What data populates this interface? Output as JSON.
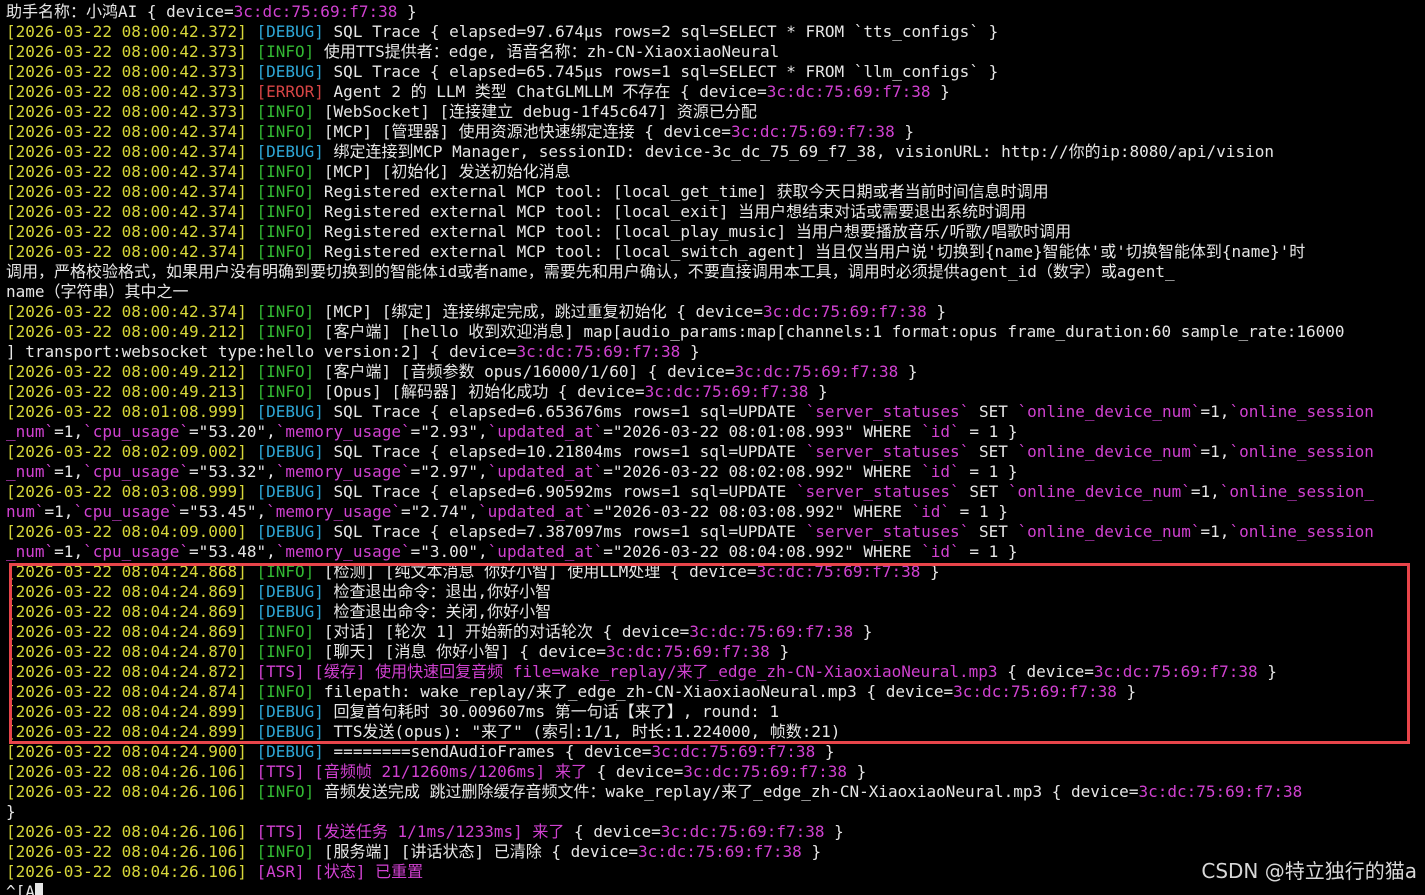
{
  "header": {
    "text": "助手名称：小鸿AI { device=",
    "device": "3c:dc:75:69:f7:38",
    "suffix": " }"
  },
  "log": [
    {
      "ts": "[2026-03-22 08:00:42.372]",
      "level": "DEBUG",
      "segs": [
        [
          "SQL Trace { elapsed=97.674µs rows=2 sql=SELECT * FROM `tts_configs` }",
          ""
        ]
      ]
    },
    {
      "ts": "[2026-03-22 08:00:42.373]",
      "level": "INFO",
      "segs": [
        [
          "使用TTS提供者：edge, 语音名称：zh-CN-XiaoxiaoNeural",
          ""
        ]
      ]
    },
    {
      "ts": "[2026-03-22 08:00:42.373]",
      "level": "DEBUG",
      "segs": [
        [
          "SQL Trace { elapsed=65.745µs rows=1 sql=SELECT * FROM `llm_configs` }",
          ""
        ]
      ]
    },
    {
      "ts": "[2026-03-22 08:00:42.373]",
      "level": "ERROR",
      "segs": [
        [
          "Agent 2 的 LLM 类型 ChatGLMLLM 不存在 { device=",
          ""
        ],
        [
          "3c:dc:75:69:f7:38",
          "hl"
        ],
        [
          " }",
          ""
        ]
      ]
    },
    {
      "ts": "[2026-03-22 08:00:42.373]",
      "level": "INFO",
      "segs": [
        [
          "[WebSocket] [连接建立 debug-1f45c647] 资源已分配",
          ""
        ]
      ]
    },
    {
      "ts": "[2026-03-22 08:00:42.374]",
      "level": "INFO",
      "segs": [
        [
          "[MCP] [管理器] 使用资源池快速绑定连接 { device=",
          ""
        ],
        [
          "3c:dc:75:69:f7:38",
          "hl"
        ],
        [
          " }",
          ""
        ]
      ]
    },
    {
      "ts": "[2026-03-22 08:00:42.374]",
      "level": "DEBUG",
      "segs": [
        [
          "绑定连接到MCP Manager, sessionID: device-3c_dc_75_69_f7_38, visionURL: http://你的ip:8080/api/vision",
          ""
        ]
      ]
    },
    {
      "ts": "[2026-03-22 08:00:42.374]",
      "level": "INFO",
      "segs": [
        [
          "[MCP] [初始化] 发送初始化消息",
          ""
        ]
      ]
    },
    {
      "ts": "[2026-03-22 08:00:42.374]",
      "level": "INFO",
      "segs": [
        [
          "Registered external MCP tool: [local_get_time] 获取今天日期或者当前时间信息时调用",
          ""
        ]
      ]
    },
    {
      "ts": "[2026-03-22 08:00:42.374]",
      "level": "INFO",
      "segs": [
        [
          "Registered external MCP tool: [local_exit] 当用户想结束对话或需要退出系统时调用",
          ""
        ]
      ]
    },
    {
      "ts": "[2026-03-22 08:00:42.374]",
      "level": "INFO",
      "segs": [
        [
          "Registered external MCP tool: [local_play_music] 当用户想要播放音乐/听歌/唱歌时调用",
          ""
        ]
      ]
    },
    {
      "ts": "[2026-03-22 08:00:42.374]",
      "level": "INFO",
      "segs": [
        [
          "Registered external MCP tool: [local_switch_agent] 当且仅当用户说'切换到{name}智能体'或'切换智能体到{name}'时",
          ""
        ]
      ]
    },
    {
      "ts": "",
      "level": "",
      "segs": [
        [
          "调用，严格校验格式，如果用户没有明确到要切换到的智能体id或者name，需要先和用户确认，不要直接调用本工具，调用时必须提供agent_id（数字）或agent_",
          ""
        ]
      ]
    },
    {
      "ts": "",
      "level": "",
      "segs": [
        [
          "name（字符串）其中之一",
          ""
        ]
      ]
    },
    {
      "ts": "[2026-03-22 08:00:42.374]",
      "level": "INFO",
      "segs": [
        [
          "[MCP] [绑定] 连接绑定完成，跳过重复初始化 { device=",
          ""
        ],
        [
          "3c:dc:75:69:f7:38",
          "hl"
        ],
        [
          " }",
          ""
        ]
      ]
    },
    {
      "ts": "[2026-03-22 08:00:49.212]",
      "level": "INFO",
      "segs": [
        [
          "[客户端] [hello 收到欢迎消息] map[audio_params:map[channels:1 format:opus frame_duration:60 sample_rate:16000",
          ""
        ]
      ]
    },
    {
      "ts": "",
      "level": "",
      "segs": [
        [
          "] transport:websocket type:hello version:2] { device=",
          ""
        ],
        [
          "3c:dc:75:69:f7:38",
          "hl"
        ],
        [
          " }",
          ""
        ]
      ]
    },
    {
      "ts": "[2026-03-22 08:00:49.212]",
      "level": "INFO",
      "segs": [
        [
          "[客户端] [音频参数 opus/16000/1/60] { device=",
          ""
        ],
        [
          "3c:dc:75:69:f7:38",
          "hl"
        ],
        [
          " }",
          ""
        ]
      ]
    },
    {
      "ts": "[2026-03-22 08:00:49.213]",
      "level": "INFO",
      "segs": [
        [
          "[Opus] [解码器] 初始化成功 { device=",
          ""
        ],
        [
          "3c:dc:75:69:f7:38",
          "hl"
        ],
        [
          " }",
          ""
        ]
      ]
    },
    {
      "ts": "[2026-03-22 08:01:08.999]",
      "level": "DEBUG",
      "segs": [
        [
          "SQL Trace { elapsed=6.653676ms rows=1 sql=UPDATE ",
          ""
        ],
        [
          "`server_statuses`",
          "hl"
        ],
        [
          " SET ",
          ""
        ],
        [
          "`online_device_num`",
          "hl"
        ],
        [
          "=1,",
          ""
        ],
        [
          "`online_session",
          "hl"
        ]
      ]
    },
    {
      "ts": "",
      "level": "",
      "segs": [
        [
          "_num`",
          "hl"
        ],
        [
          "=1,",
          ""
        ],
        [
          "`cpu_usage`",
          "hl"
        ],
        [
          "=\"53.20\",",
          ""
        ],
        [
          "`memory_usage`",
          "hl"
        ],
        [
          "=\"2.93\",",
          ""
        ],
        [
          "`updated_at`",
          "hl"
        ],
        [
          "=\"2026-03-22 08:01:08.993\" WHERE ",
          ""
        ],
        [
          "`id`",
          "hl"
        ],
        [
          " = 1 }",
          ""
        ]
      ]
    },
    {
      "ts": "[2026-03-22 08:02:09.002]",
      "level": "DEBUG",
      "segs": [
        [
          "SQL Trace { elapsed=10.21804ms rows=1 sql=UPDATE ",
          ""
        ],
        [
          "`server_statuses`",
          "hl"
        ],
        [
          " SET ",
          ""
        ],
        [
          "`online_device_num`",
          "hl"
        ],
        [
          "=1,",
          ""
        ],
        [
          "`online_session",
          "hl"
        ]
      ]
    },
    {
      "ts": "",
      "level": "",
      "segs": [
        [
          "_num`",
          "hl"
        ],
        [
          "=1,",
          ""
        ],
        [
          "`cpu_usage`",
          "hl"
        ],
        [
          "=\"53.32\",",
          ""
        ],
        [
          "`memory_usage`",
          "hl"
        ],
        [
          "=\"2.97\",",
          ""
        ],
        [
          "`updated_at`",
          "hl"
        ],
        [
          "=\"2026-03-22 08:02:08.992\" WHERE ",
          ""
        ],
        [
          "`id`",
          "hl"
        ],
        [
          " = 1 }",
          ""
        ]
      ]
    },
    {
      "ts": "[2026-03-22 08:03:08.999]",
      "level": "DEBUG",
      "segs": [
        [
          "SQL Trace { elapsed=6.90592ms rows=1 sql=UPDATE ",
          ""
        ],
        [
          "`server_statuses`",
          "hl"
        ],
        [
          " SET ",
          ""
        ],
        [
          "`online_device_num`",
          "hl"
        ],
        [
          "=1,",
          ""
        ],
        [
          "`online_session_",
          "hl"
        ]
      ]
    },
    {
      "ts": "",
      "level": "",
      "segs": [
        [
          "num`",
          "hl"
        ],
        [
          "=1,",
          ""
        ],
        [
          "`cpu_usage`",
          "hl"
        ],
        [
          "=\"53.45\",",
          ""
        ],
        [
          "`memory_usage`",
          "hl"
        ],
        [
          "=\"2.74\",",
          ""
        ],
        [
          "`updated_at`",
          "hl"
        ],
        [
          "=\"2026-03-22 08:03:08.992\" WHERE ",
          ""
        ],
        [
          "`id`",
          "hl"
        ],
        [
          " = 1 }",
          ""
        ]
      ]
    },
    {
      "ts": "[2026-03-22 08:04:09.000]",
      "level": "DEBUG",
      "segs": [
        [
          "SQL Trace { elapsed=7.387097ms rows=1 sql=UPDATE ",
          ""
        ],
        [
          "`server_statuses`",
          "hl"
        ],
        [
          " SET ",
          ""
        ],
        [
          "`online_device_num`",
          "hl"
        ],
        [
          "=1,",
          ""
        ],
        [
          "`online_session",
          "hl"
        ]
      ]
    },
    {
      "ts": "",
      "level": "",
      "segs": [
        [
          "_num`",
          "hl"
        ],
        [
          "=1,",
          ""
        ],
        [
          "`cpu_usage`",
          "hl"
        ],
        [
          "=\"53.48\",",
          ""
        ],
        [
          "`memory_usage`",
          "hl"
        ],
        [
          "=\"3.00\",",
          ""
        ],
        [
          "`updated_at`",
          "hl"
        ],
        [
          "=\"2026-03-22 08:04:08.992\" WHERE ",
          ""
        ],
        [
          "`id`",
          "hl"
        ],
        [
          " = 1 }",
          ""
        ]
      ]
    },
    {
      "ts": "[2026-03-22 08:04:24.868]",
      "level": "INFO",
      "segs": [
        [
          "[检测] [纯文本消息 你好小智] 使用LLM处理 { device=",
          ""
        ],
        [
          "3c:dc:75:69:f7:38",
          "hl"
        ],
        [
          " }",
          ""
        ]
      ]
    },
    {
      "ts": "[2026-03-22 08:04:24.869]",
      "level": "DEBUG",
      "segs": [
        [
          "检查退出命令：退出,你好小智",
          ""
        ]
      ]
    },
    {
      "ts": "[2026-03-22 08:04:24.869]",
      "level": "DEBUG",
      "segs": [
        [
          "检查退出命令：关闭,你好小智",
          ""
        ]
      ]
    },
    {
      "ts": "[2026-03-22 08:04:24.869]",
      "level": "INFO",
      "segs": [
        [
          "[对话] [轮次 1] 开始新的对话轮次 { device=",
          ""
        ],
        [
          "3c:dc:75:69:f7:38",
          "hl"
        ],
        [
          " }",
          ""
        ]
      ]
    },
    {
      "ts": "[2026-03-22 08:04:24.870]",
      "level": "INFO",
      "segs": [
        [
          "[聊天] [消息 你好小智] { device=",
          ""
        ],
        [
          "3c:dc:75:69:f7:38",
          "hl"
        ],
        [
          " }",
          ""
        ]
      ]
    },
    {
      "ts": "[2026-03-22 08:04:24.872]",
      "level": "TTS",
      "segs": [
        [
          "[缓存] 使用快速回复音频 file=wake_replay/来了_edge_zh-CN-XiaoxiaoNeural.mp3",
          "ttsmsg"
        ],
        [
          " { device=",
          ""
        ],
        [
          "3c:dc:75:69:f7:38",
          "hl"
        ],
        [
          " }",
          ""
        ]
      ]
    },
    {
      "ts": "[2026-03-22 08:04:24.874]",
      "level": "INFO",
      "segs": [
        [
          "filepath: wake_replay/来了_edge_zh-CN-XiaoxiaoNeural.mp3 { device=",
          ""
        ],
        [
          "3c:dc:75:69:f7:38",
          "hl"
        ],
        [
          " }",
          ""
        ]
      ]
    },
    {
      "ts": "[2026-03-22 08:04:24.899]",
      "level": "DEBUG",
      "segs": [
        [
          "回复首句耗时 30.009607ms 第一句话【来了】, round: 1",
          ""
        ]
      ]
    },
    {
      "ts": "[2026-03-22 08:04:24.899]",
      "level": "DEBUG",
      "segs": [
        [
          "TTS发送(opus): \"来了\" (索引:1/1, 时长:1.224000, 帧数:21)",
          ""
        ]
      ]
    },
    {
      "ts": "[2026-03-22 08:04:24.900]",
      "level": "DEBUG",
      "segs": [
        [
          "========sendAudioFrames { device=",
          ""
        ],
        [
          "3c:dc:75:69:f7:38",
          "hl"
        ],
        [
          " }",
          ""
        ]
      ]
    },
    {
      "ts": "[2026-03-22 08:04:26.106]",
      "level": "TTS",
      "segs": [
        [
          "[音频帧 21/1260ms/1206ms] 来了",
          "ttsmsg"
        ],
        [
          " { device=",
          ""
        ],
        [
          "3c:dc:75:69:f7:38",
          "hl"
        ],
        [
          " }",
          ""
        ]
      ]
    },
    {
      "ts": "[2026-03-22 08:04:26.106]",
      "level": "INFO",
      "segs": [
        [
          "音频发送完成 跳过删除缓存音频文件：wake_replay/来了_edge_zh-CN-XiaoxiaoNeural.mp3 { device=",
          ""
        ],
        [
          "3c:dc:75:69:f7:38",
          "hl"
        ]
      ]
    },
    {
      "ts": "",
      "level": "",
      "segs": [
        [
          "}",
          ""
        ]
      ]
    },
    {
      "ts": "[2026-03-22 08:04:26.106]",
      "level": "TTS",
      "segs": [
        [
          "[发送任务 1/1ms/1233ms] 来了",
          "ttsmsg"
        ],
        [
          " { device=",
          ""
        ],
        [
          "3c:dc:75:69:f7:38",
          "hl"
        ],
        [
          " }",
          ""
        ]
      ]
    },
    {
      "ts": "[2026-03-22 08:04:26.106]",
      "level": "INFO",
      "segs": [
        [
          "[服务端] [讲话状态] 已清除 { device=",
          ""
        ],
        [
          "3c:dc:75:69:f7:38",
          "hl"
        ],
        [
          " }",
          ""
        ]
      ]
    },
    {
      "ts": "[2026-03-22 08:04:26.106]",
      "level": "ASR",
      "segs": [
        [
          "[状态] 已重置",
          "ttsmsg"
        ]
      ]
    }
  ],
  "prompt": "^[A",
  "watermark": "CSDN @特立独行的猫a",
  "colors": {
    "background": "#000000",
    "timestamp": "#d6d639",
    "debug": "#2ea8d8",
    "info": "#33b833",
    "error": "#d64545",
    "magenta": "#d041d0",
    "highlight_box": "#e8454a"
  }
}
